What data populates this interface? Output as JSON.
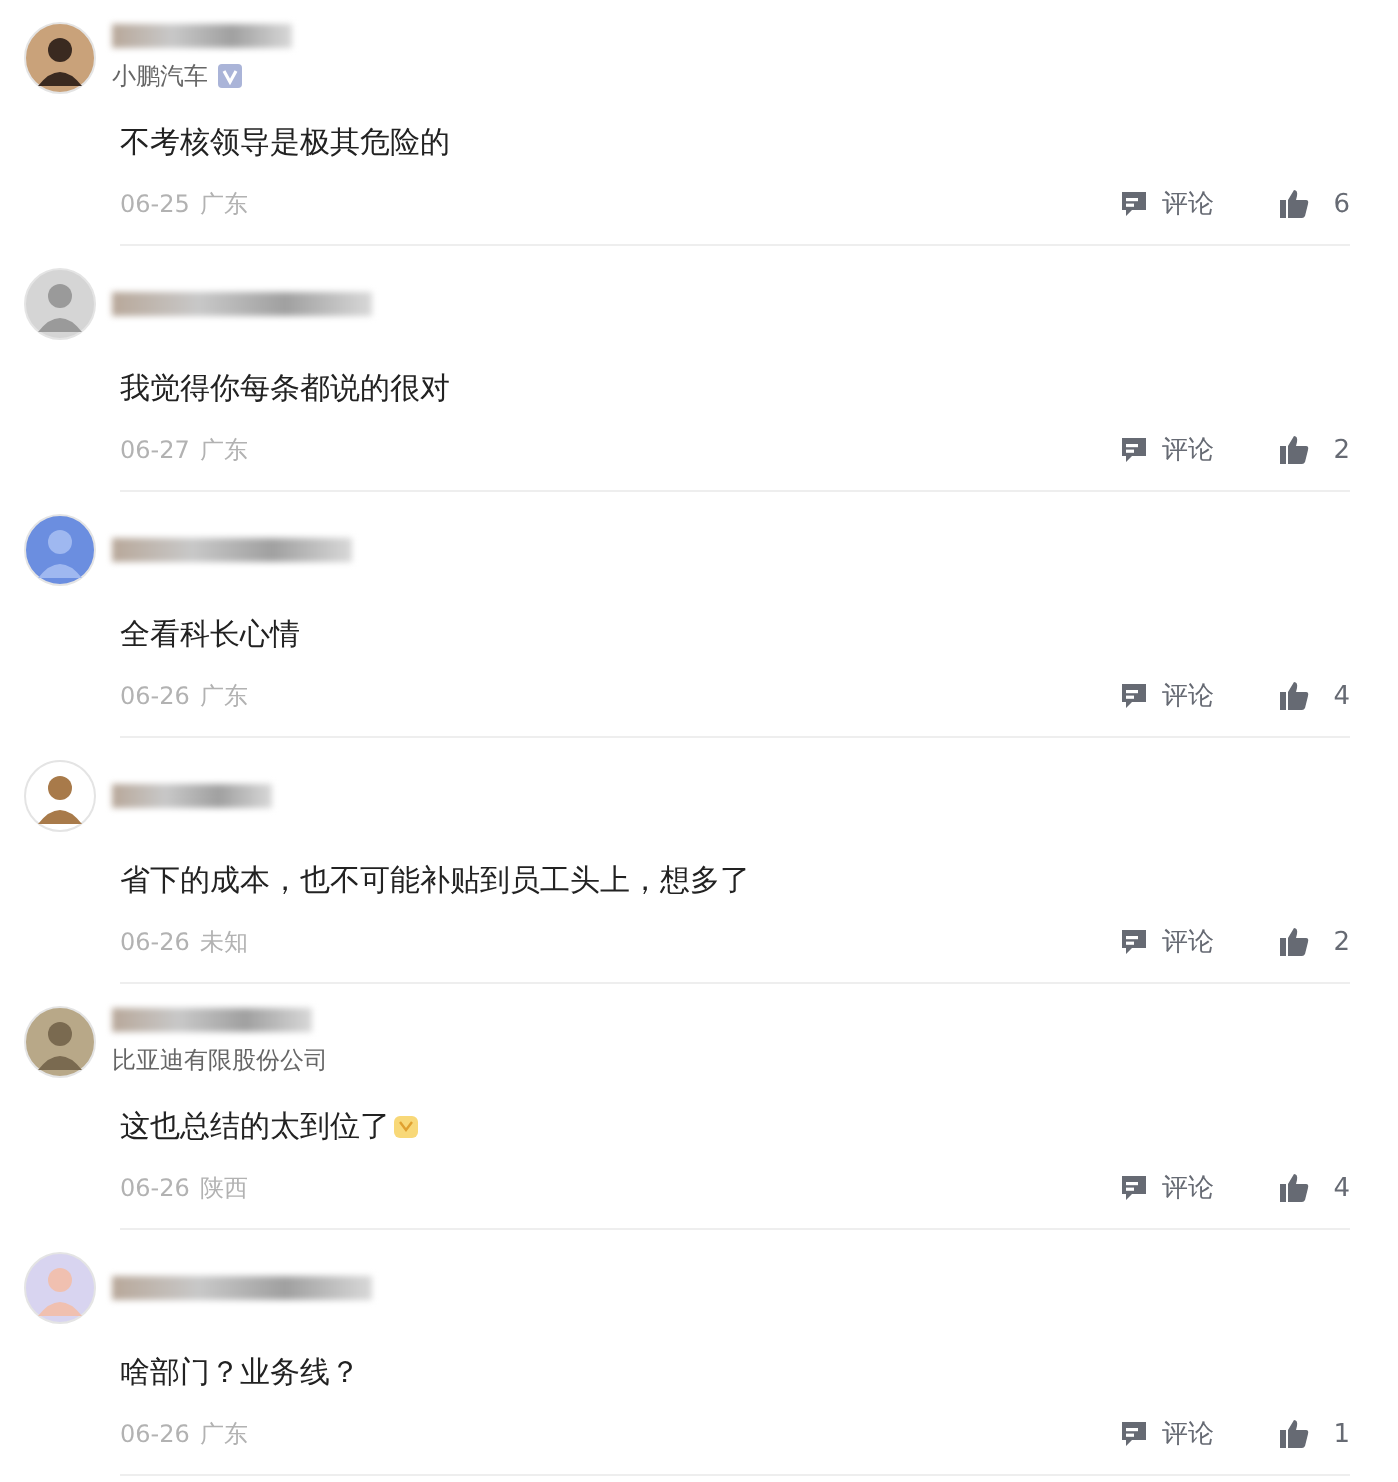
{
  "comments": [
    {
      "company": "小鹏汽车",
      "verified": true,
      "text": "不考核领导是极其危险的",
      "emoji": false,
      "date": "06-25",
      "location": "广东",
      "comment_label": "评论",
      "likes": "6"
    },
    {
      "text": "我觉得你每条都说的很对",
      "verified": false,
      "emoji": false,
      "date": "06-27",
      "location": "广东",
      "comment_label": "评论",
      "likes": "2"
    },
    {
      "text": "全看科长心情",
      "verified": false,
      "emoji": false,
      "date": "06-26",
      "location": "广东",
      "comment_label": "评论",
      "likes": "4"
    },
    {
      "text": "省下的成本，也不可能补贴到员工头上，想多了",
      "verified": false,
      "emoji": false,
      "date": "06-26",
      "location": "未知",
      "comment_label": "评论",
      "likes": "2"
    },
    {
      "company": "比亚迪有限股份公司",
      "verified": false,
      "text": "这也总结的太到位了",
      "emoji": true,
      "date": "06-26",
      "location": "陕西",
      "comment_label": "评论",
      "likes": "4"
    },
    {
      "text": "啥部门？业务线？",
      "verified": false,
      "emoji": false,
      "date": "06-26",
      "location": "广东",
      "comment_label": "评论",
      "likes": "1"
    }
  ]
}
